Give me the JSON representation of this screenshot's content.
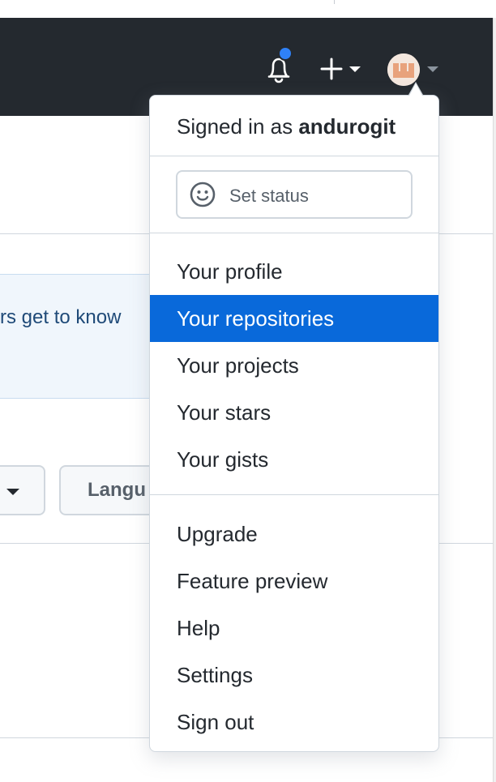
{
  "header": {
    "notification_dot_color": "#2f81f7",
    "icons": [
      "bell-icon",
      "plus-icon",
      "avatar"
    ]
  },
  "background": {
    "banner_text": "rs get to know",
    "language_button_label": "Langu"
  },
  "dropdown": {
    "signed_in_prefix": "Signed in as",
    "username": "andurogit",
    "set_status_label": "Set status",
    "group1": [
      "Your profile",
      "Your repositories",
      "Your projects",
      "Your stars",
      "Your gists"
    ],
    "group2": [
      "Upgrade",
      "Feature preview",
      "Help",
      "Settings",
      "Sign out"
    ],
    "active_item": "Your repositories",
    "accent_color": "#0969da"
  }
}
